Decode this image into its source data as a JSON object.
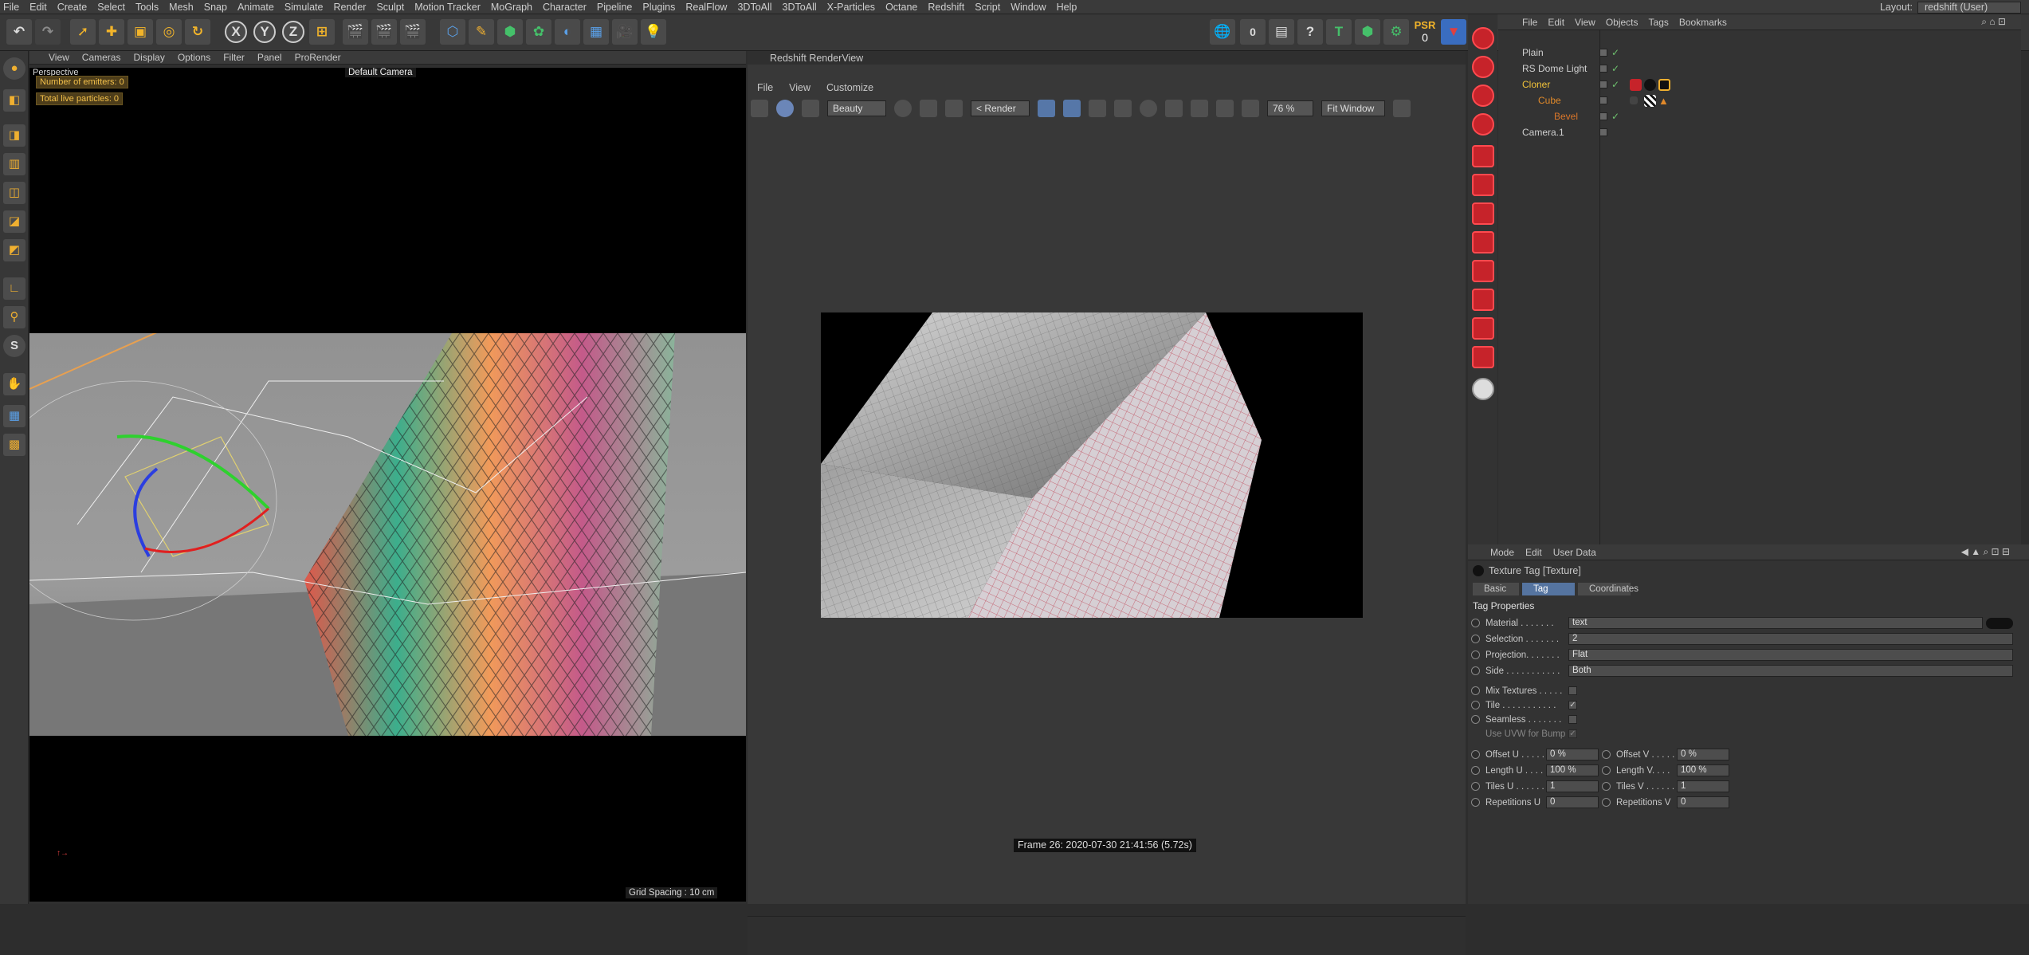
{
  "menu": [
    "File",
    "Edit",
    "Create",
    "Select",
    "Tools",
    "Mesh",
    "Snap",
    "Animate",
    "Simulate",
    "Render",
    "Sculpt",
    "Motion Tracker",
    "MoGraph",
    "Character",
    "Pipeline",
    "Plugins",
    "RealFlow",
    "3DToAll",
    "3DToAll",
    "X-Particles",
    "Octane",
    "Redshift",
    "Script",
    "Window",
    "Help"
  ],
  "layout": {
    "label": "Layout:",
    "value": "redshift (User)"
  },
  "toolbar": {
    "x": "X",
    "y": "Y",
    "z": "Z",
    "psr": "PSR",
    "psr_val": "0",
    "counter": "0"
  },
  "viewport": {
    "menu": [
      "View",
      "Cameras",
      "Display",
      "Options",
      "Filter",
      "Panel",
      "ProRender"
    ],
    "label": "Perspective",
    "camera": "Default Camera",
    "hud1": "Number of emitters: 0",
    "hud2": "Total live particles: 0",
    "grid": "Grid Spacing : 10 cm"
  },
  "renderview": {
    "title": "Redshift RenderView",
    "menu": [
      "File",
      "View",
      "Customize"
    ],
    "aov": "Beauty",
    "render": "< Render",
    "zoom": "76 %",
    "fit": "Fit Window",
    "frame": "Frame  26:  2020-07-30  21:41:56  (5.72s)"
  },
  "objects": {
    "menu": [
      "File",
      "Edit",
      "View",
      "Objects",
      "Tags",
      "Bookmarks"
    ],
    "rows": [
      {
        "name": "Plain",
        "color": "#cfcfcf"
      },
      {
        "name": "RS Dome Light",
        "color": "#cfcfcf"
      },
      {
        "name": "Cloner",
        "color": "#f0c23a"
      },
      {
        "name": "Cube",
        "color": "#e0892a"
      },
      {
        "name": "Bevel",
        "color": "#d9762a"
      },
      {
        "name": "Camera.1",
        "color": "#cfcfcf"
      }
    ]
  },
  "attributes": {
    "menu": [
      "Mode",
      "Edit",
      "User Data"
    ],
    "title": "Texture Tag [Texture]",
    "tabs": [
      "Basic",
      "Tag",
      "Coordinates"
    ],
    "section": "Tag Properties",
    "material_label": "Material . . . . . . .",
    "material": "text",
    "selection_label": "Selection . . . . . . .",
    "selection": "2",
    "projection_label": "Projection. . . . . . .",
    "projection": "Flat",
    "side_label": "Side . . . . . . . . . . .",
    "side": "Both",
    "mix_label": "Mix Textures . . . . .",
    "tile_label": "Tile . . . . . . . . . . .",
    "seamless_label": "Seamless . . . . . . .",
    "uvw_label": "Use UVW for Bump",
    "offset_u_label": "Offset U . . . . .",
    "offset_u": "0 %",
    "offset_v_label": "Offset V . . . . .",
    "offset_v": "0 %",
    "length_u_label": "Length U . . . .",
    "length_u": "100 %",
    "length_v_label": "Length V. . . .",
    "length_v": "100 %",
    "tiles_u_label": "Tiles U . . . . . .",
    "tiles_u": "1",
    "tiles_v_label": "Tiles V . . . . . .",
    "tiles_v": "1",
    "rep_u_label": "Repetitions U",
    "rep_u": "0",
    "rep_v_label": "Repetitions V",
    "rep_v": "0"
  }
}
